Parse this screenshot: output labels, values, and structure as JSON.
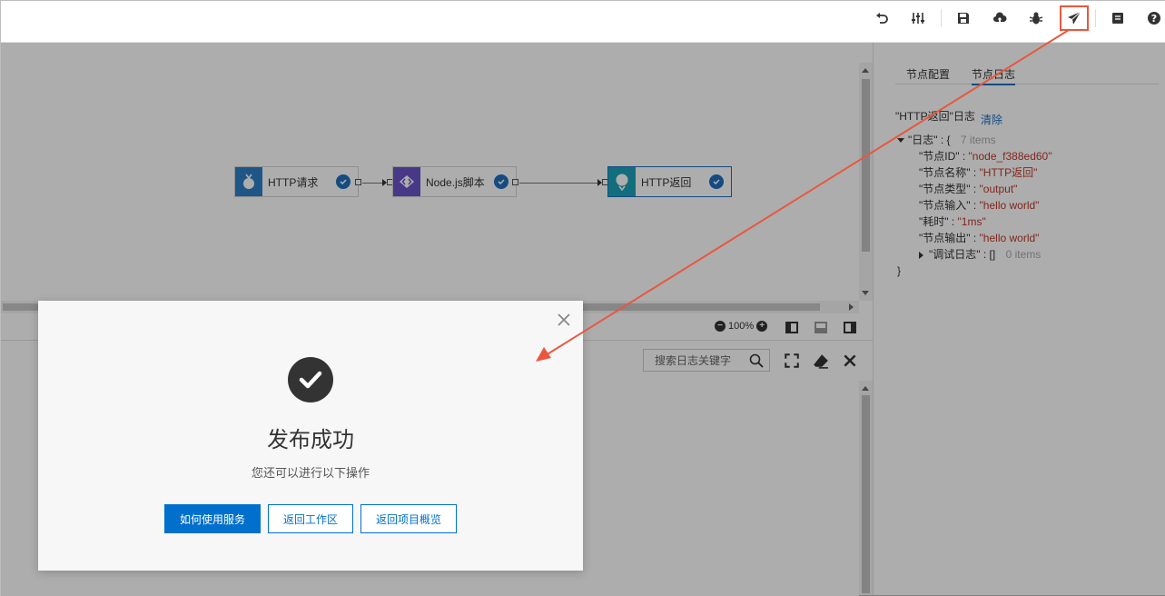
{
  "toolbar": {
    "icons": [
      "undo-icon",
      "settings-sliders-icon",
      "save-icon",
      "cloud-upload-icon",
      "debug-bug-icon",
      "publish-send-icon",
      "document-icon",
      "help-icon"
    ],
    "highlight_color": "#e9573f"
  },
  "canvas": {
    "nodes": [
      {
        "label": "HTTP请求",
        "icon": "http-request-icon",
        "color": "#2d7fc9"
      },
      {
        "label": "Node.js脚本",
        "icon": "code-script-icon",
        "color": "#6b55c9"
      },
      {
        "label": "HTTP返回",
        "icon": "http-response-icon",
        "color": "#1ba2b8"
      }
    ]
  },
  "right_panel": {
    "tabs": [
      {
        "label": "节点配置"
      },
      {
        "label": "节点日志"
      }
    ],
    "log_title": "\"HTTP返回\"日志",
    "clear_label": "清除",
    "json": {
      "root_key": "\"日志\"",
      "root_count": "7 items",
      "entries": [
        {
          "key": "\"节点ID\"",
          "value": "\"node_f388ed60\""
        },
        {
          "key": "\"节点名称\"",
          "value": "\"HTTP返回\""
        },
        {
          "key": "\"节点类型\"",
          "value": "\"output\""
        },
        {
          "key": "\"节点输入\"",
          "value": "\"hello world\""
        },
        {
          "key": "\"耗时\"",
          "value": "\"1ms\""
        },
        {
          "key": "\"节点输出\"",
          "value": "\"hello world\""
        }
      ],
      "debug_key": "\"调试日志\"",
      "debug_value": "[]",
      "debug_count": "0 items"
    }
  },
  "bottom": {
    "zoom": "100%",
    "search_placeholder": "搜索日志关键字"
  },
  "modal": {
    "title": "发布成功",
    "subtitle": "您还可以进行以下操作",
    "buttons": [
      {
        "label": "如何使用服务"
      },
      {
        "label": "返回工作区"
      },
      {
        "label": "返回项目概览"
      }
    ]
  }
}
